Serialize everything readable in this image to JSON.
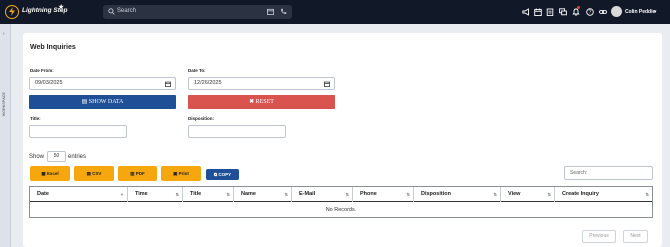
{
  "topbar": {
    "brand": "Lightning Step",
    "search_placeholder": "Search",
    "user_name": "Colin Peddie",
    "icons": [
      "megaphone-icon",
      "calendar-icon",
      "clipboard-icon",
      "chat-icon",
      "bell-icon",
      "help-icon",
      "link-icon"
    ]
  },
  "sidebar": {
    "label": "WORKSPACE"
  },
  "page": {
    "title": "Web Inquiries"
  },
  "filters": {
    "date_from_label": "Date From:",
    "date_from_value": "09/03/2025",
    "date_to_label": "Date To:",
    "date_to_value": "12/26/2025",
    "show_data_label": "SHOW DATA",
    "reset_label": "RESET",
    "title_label": "Title:",
    "disposition_label": "Disposition:"
  },
  "entries": {
    "show_label": "Show",
    "count": "50",
    "entries_label": "entries"
  },
  "exports": {
    "excel": "Excel",
    "csv": "CSV",
    "pdf": "PDF",
    "print": "Print",
    "copy": "COPY"
  },
  "table_search": {
    "placeholder": "Search:"
  },
  "table": {
    "columns": [
      "Date",
      "Time",
      "Title",
      "Name",
      "E-Mail",
      "Phone",
      "Disposition",
      "View",
      "Create Inquiry"
    ],
    "empty_text": "No Records."
  },
  "pagination": {
    "previous": "Previous",
    "next": "Next"
  },
  "colors": {
    "primary": "#1f4f97",
    "danger": "#d9534f",
    "export": "#f5a70d",
    "topbar": "#111827"
  }
}
